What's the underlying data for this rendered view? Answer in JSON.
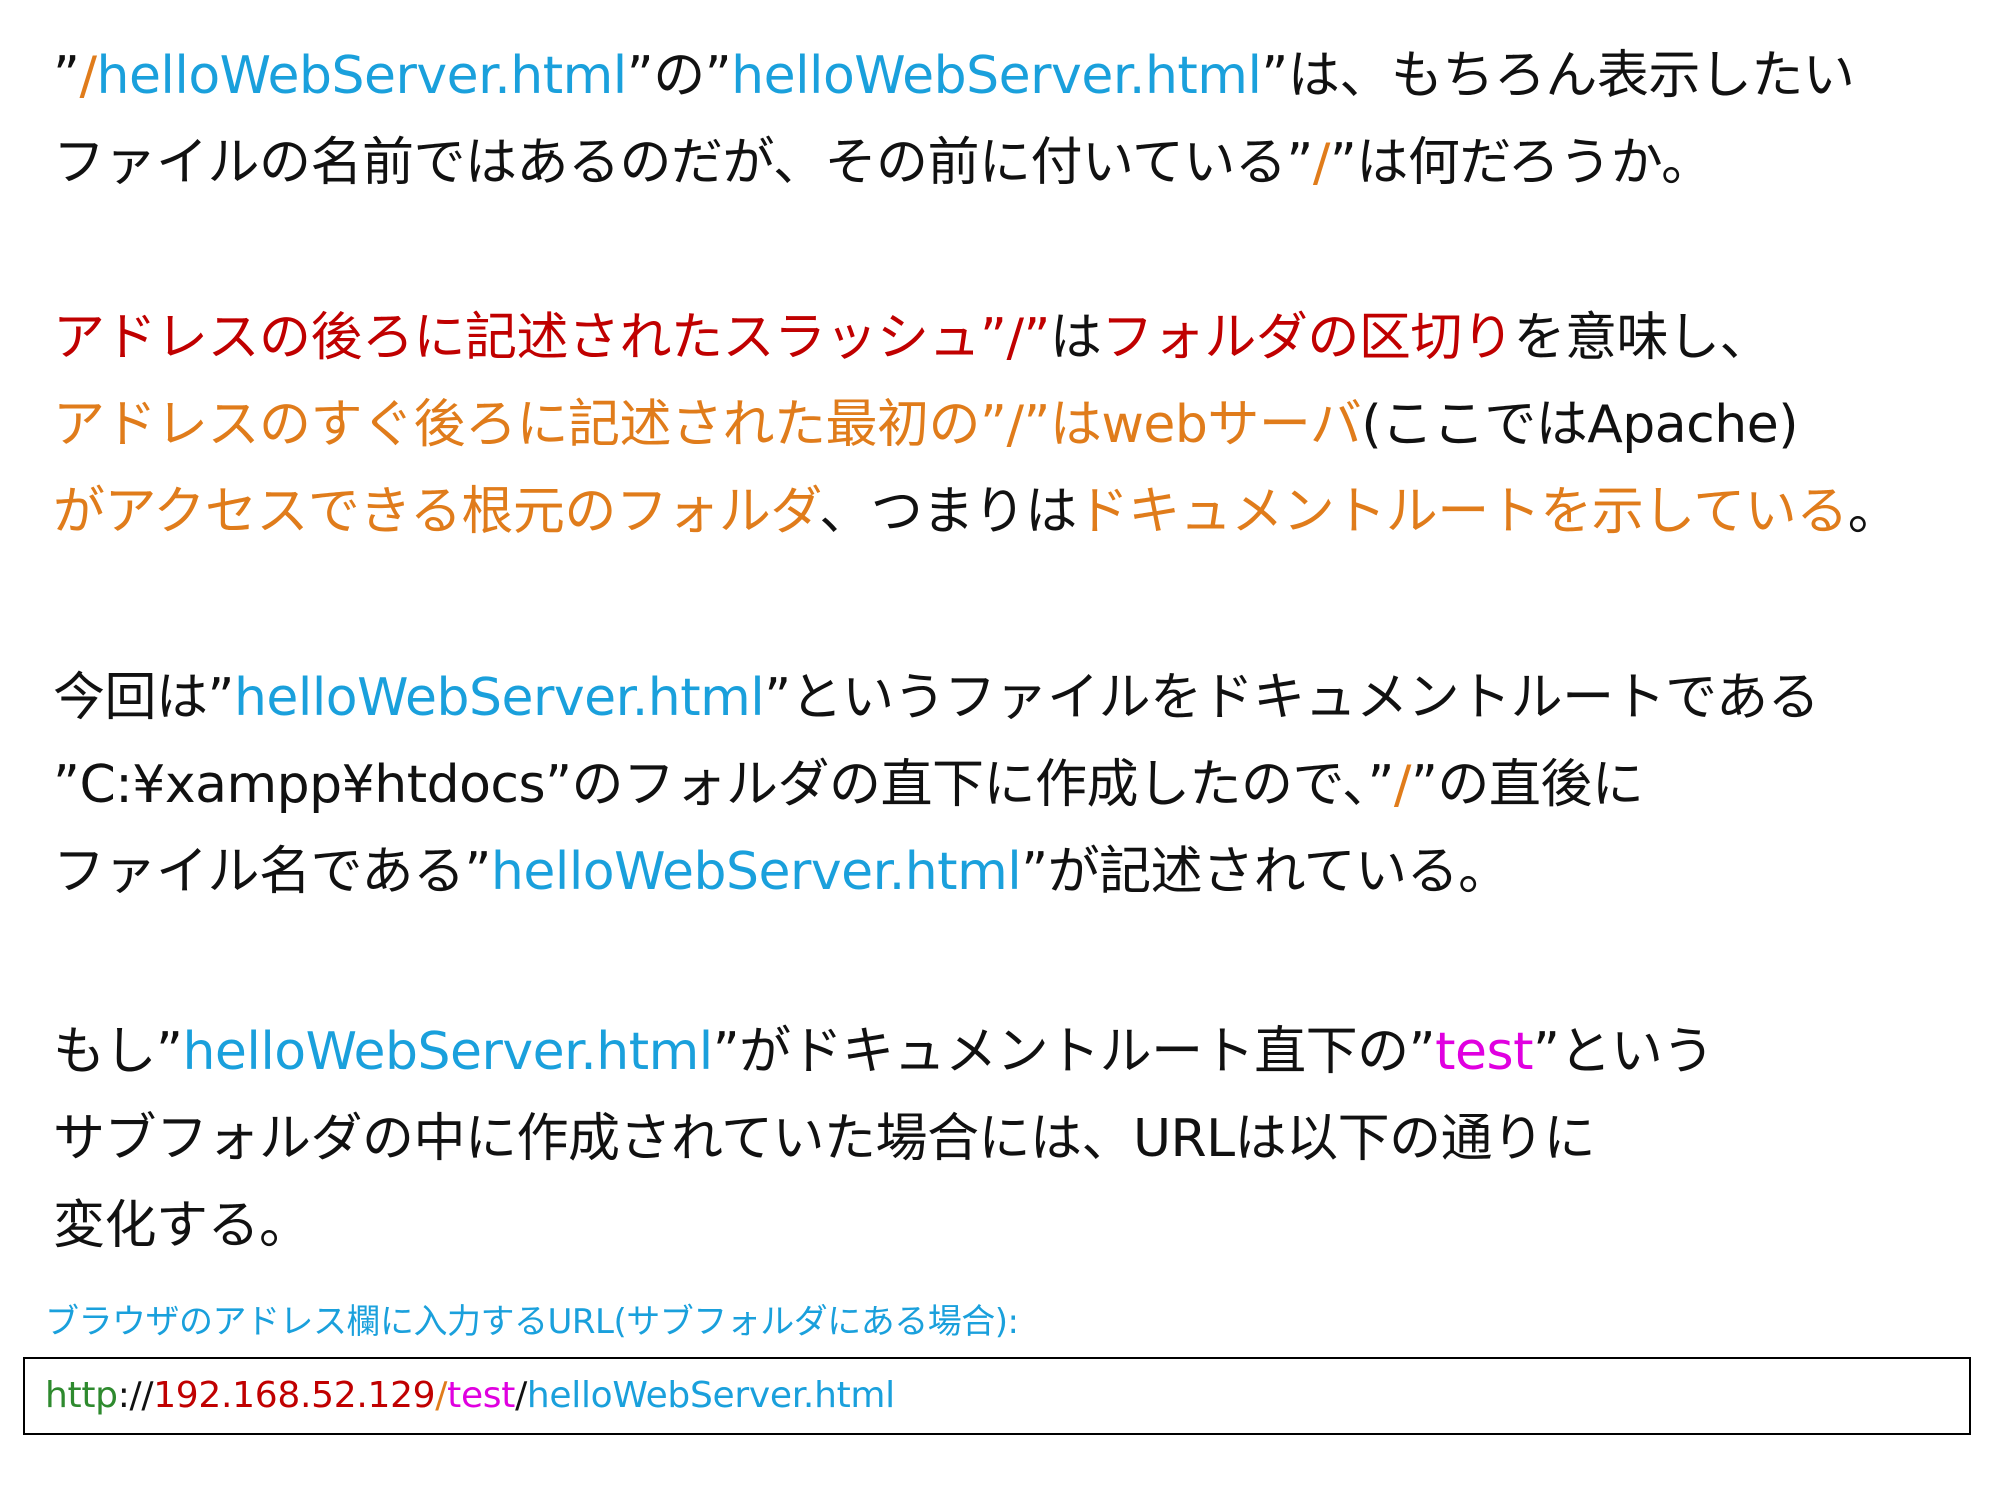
{
  "paragraphs": [
    {
      "lines": [
        [
          {
            "t": "”",
            "c": "black"
          },
          {
            "t": "/",
            "c": "orange"
          },
          {
            "t": "helloWebServer.html",
            "c": "blue"
          },
          {
            "t": "”の”",
            "c": "black"
          },
          {
            "t": "helloWebServer.html",
            "c": "blue"
          },
          {
            "t": "”は、もちろん表示したい",
            "c": "black"
          }
        ],
        [
          {
            "t": "ファイルの名前ではあるのだが、その前に付いている”",
            "c": "black"
          },
          {
            "t": "/",
            "c": "orange"
          },
          {
            "t": "”は何だろうか。",
            "c": "black"
          }
        ]
      ]
    },
    {
      "lines": [
        [
          {
            "t": "アドレスの後ろに記述されたスラッシュ”/”",
            "c": "red"
          },
          {
            "t": "は",
            "c": "black"
          },
          {
            "t": "フォルダの区切り",
            "c": "red"
          },
          {
            "t": "を意味し、",
            "c": "black"
          }
        ],
        [
          {
            "t": "アドレスのすぐ後ろに記述された最初の”/”はwebサーバ",
            "c": "orange"
          },
          {
            "t": "(ここではApache)",
            "c": "black"
          }
        ],
        [
          {
            "t": "がアクセスできる根元のフォルダ",
            "c": "orange"
          },
          {
            "t": "、つまりは",
            "c": "black"
          },
          {
            "t": "ドキュメントルートを示している",
            "c": "orange"
          },
          {
            "t": "。",
            "c": "black"
          }
        ]
      ]
    },
    {
      "lines": [
        [
          {
            "t": "今回は”",
            "c": "black"
          },
          {
            "t": "helloWebServer.html",
            "c": "blue"
          },
          {
            "t": "”というファイルをドキュメントルートである",
            "c": "black"
          }
        ],
        [
          {
            "t": "”C:¥xampp¥htdocs”のフォルダの直下に作成したので、”",
            "c": "black"
          },
          {
            "t": "/",
            "c": "orange"
          },
          {
            "t": "”の直後に",
            "c": "black"
          }
        ],
        [
          {
            "t": "ファイル名である”",
            "c": "black"
          },
          {
            "t": "helloWebServer.html",
            "c": "blue"
          },
          {
            "t": "”が記述されている。",
            "c": "black"
          }
        ]
      ]
    },
    {
      "lines": [
        [
          {
            "t": "もし”",
            "c": "black"
          },
          {
            "t": "helloWebServer.html",
            "c": "blue"
          },
          {
            "t": "”がドキュメントルート直下の”",
            "c": "black"
          },
          {
            "t": "test",
            "c": "magenta"
          },
          {
            "t": "”という",
            "c": "black"
          }
        ],
        [
          {
            "t": "サブフォルダの中に作成されていた場合には、URLは以下の通りに",
            "c": "black"
          }
        ],
        [
          {
            "t": "変化する。",
            "c": "black"
          }
        ]
      ]
    }
  ],
  "url_caption": "ブラウザのアドレス欄に入力するURL(サブフォルダにある場合):",
  "url_parts": [
    {
      "t": "http",
      "c": "green"
    },
    {
      "t": "://",
      "c": "black"
    },
    {
      "t": "192.168.52.129",
      "c": "red"
    },
    {
      "t": "/",
      "c": "orange"
    },
    {
      "t": "test",
      "c": "magenta"
    },
    {
      "t": "/",
      "c": "black"
    },
    {
      "t": "helloWebServer.html",
      "c": "blue"
    }
  ],
  "colors": {
    "black": "#111111",
    "blue": "#1aa0dc",
    "orange": "#e07c1b",
    "red": "#c00000",
    "magenta": "#e000e0",
    "green": "#2e8a2e"
  }
}
